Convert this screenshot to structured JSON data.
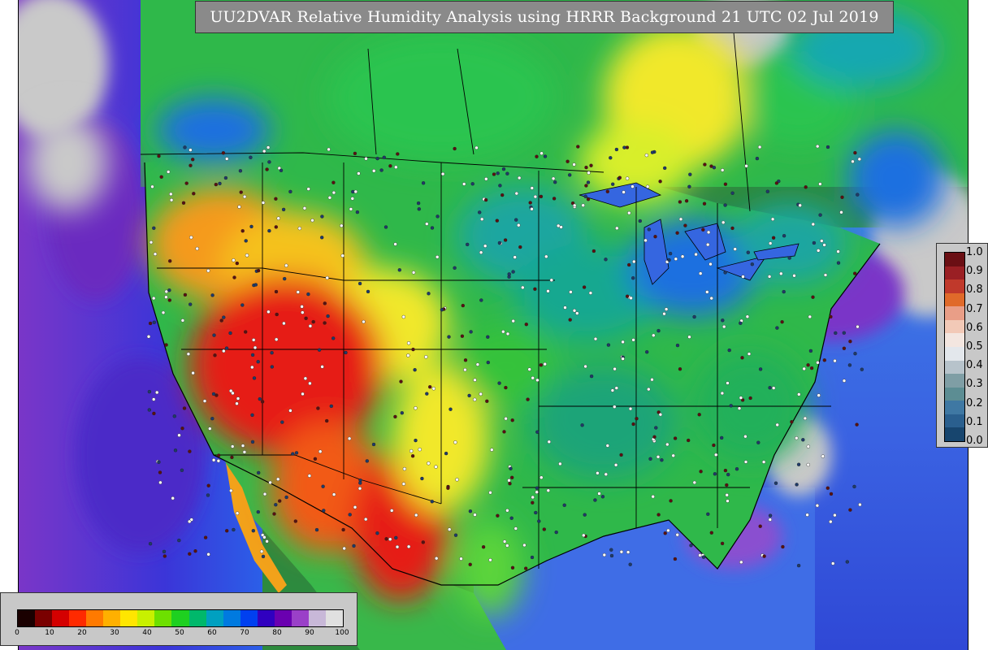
{
  "title": "UU2DVAR Relative Humidity Analysis using HRRR Background 21 UTC 02 Jul 2019",
  "ratio_scale": {
    "labels": [
      "1.0",
      "0.9",
      "0.8",
      "0.7",
      "0.6",
      "0.5",
      "0.4",
      "0.3",
      "0.2",
      "0.1",
      "0.0"
    ],
    "colors": [
      "#6b0f14",
      "#9a1f24",
      "#c0392b",
      "#e06a2a",
      "#e99e87",
      "#f2c9b7",
      "#f3e6e0",
      "#e3e7ec",
      "#b7c3cb",
      "#7f9ea5",
      "#5c8d93",
      "#3f78a3",
      "#2a5f8e",
      "#17456e"
    ]
  },
  "rh_scale": {
    "ticks": [
      "0",
      "10",
      "20",
      "30",
      "40",
      "50",
      "60",
      "70",
      "80",
      "90",
      "100"
    ],
    "colors": [
      "#1a0000",
      "#7a0000",
      "#d40000",
      "#ff2a00",
      "#ff7a00",
      "#ffb000",
      "#ffe600",
      "#c8f000",
      "#6de000",
      "#1ed020",
      "#00b86b",
      "#00a0c0",
      "#007ae0",
      "#0040f0",
      "#3000c0",
      "#6a00b0",
      "#9a40c8",
      "#c8b8d8",
      "#e0e0e0"
    ]
  },
  "map_palette": {
    "ocean_deep": "#2b3fd8",
    "ocean_mid": "#3d6de8",
    "ocean_purple": "#7a36c8",
    "land_green": "#2fb84a",
    "dry_red": "#e61e12",
    "dry_orange": "#f59a1a",
    "yellow": "#f1e82a",
    "teal": "#1aa6a0",
    "blue_wet": "#1f6fe0",
    "gray_nodata": "#c9c9c9",
    "border": "#000000"
  }
}
